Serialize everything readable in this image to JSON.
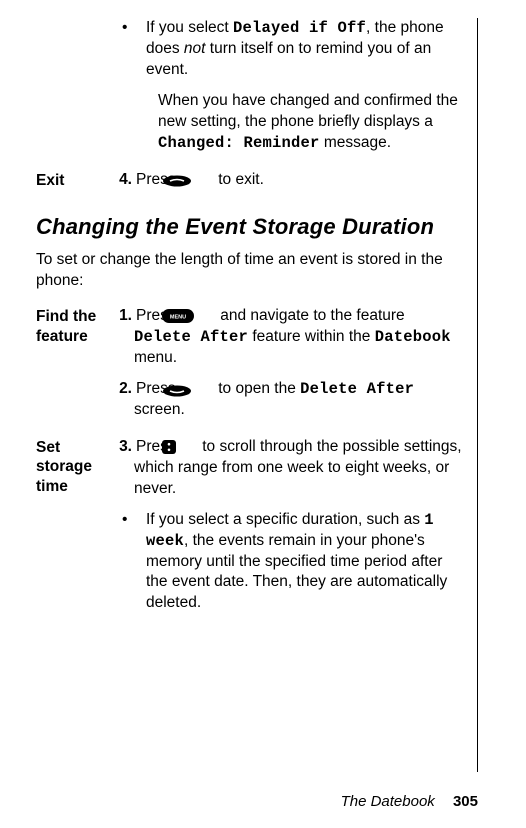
{
  "top": {
    "bullet_pre": "If you select ",
    "bullet_code": "Delayed if Off",
    "bullet_mid": ", the phone does ",
    "bullet_ital": "not ",
    "bullet_post": "turn itself on to remind you of an event.",
    "sub_pre": "When you have changed and confirmed the new setting, the phone briefly displays a ",
    "sub_code": "Changed: Reminder",
    "sub_post": " message."
  },
  "exit": {
    "label": "Exit",
    "num": "4.",
    "pre": "Press ",
    "post": " to exit."
  },
  "section_title": "Changing the Event Storage Duration",
  "intro": "To set or change the length of time an event is stored in the phone:",
  "find": {
    "label": "Find the feature",
    "s1": {
      "num": "1.",
      "pre": "Press ",
      "mid1": " and navigate to the feature ",
      "code1": "Delete After",
      "mid2": " feature within the ",
      "code2": "Datebook",
      "post": " menu."
    },
    "s2": {
      "num": "2.",
      "pre": "Press ",
      "mid": " to open the ",
      "code": "Delete After",
      "post": " screen."
    }
  },
  "storage": {
    "label": "Set storage time",
    "s3": {
      "num": "3.",
      "pre": "Press ",
      "post": " to scroll through the possible settings, which range from one week to eight weeks, or never."
    },
    "bullet": {
      "pre": "If you select a specific duration, such as ",
      "code": "1 week",
      "post": ", the events remain in your phone's memory until the specified time period after the event date. Then, they are automatically deleted."
    }
  },
  "footer": {
    "title": "The Datebook",
    "page": "305"
  },
  "icons": {
    "menu_text": "MENU"
  }
}
